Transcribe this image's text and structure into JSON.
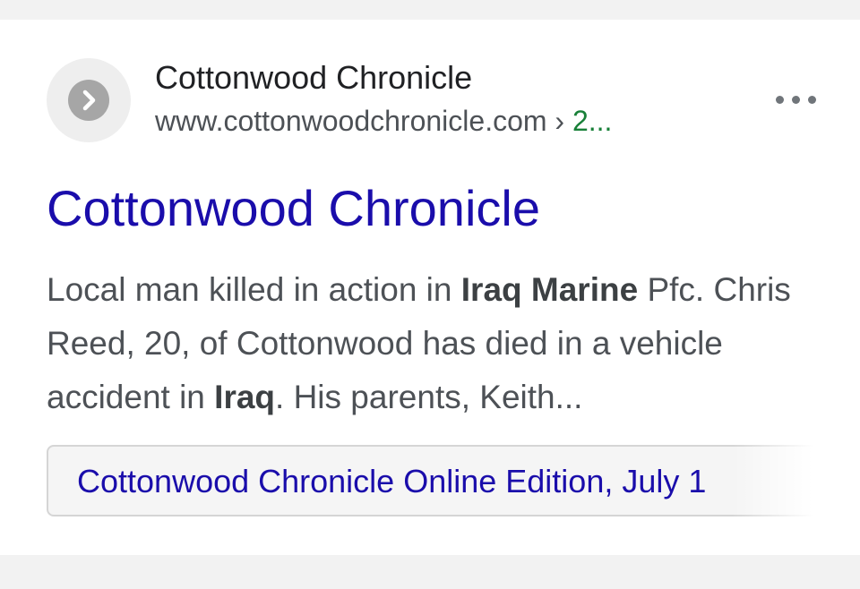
{
  "result": {
    "site_name": "Cottonwood Chronicle",
    "site_url": "www.cottonwoodchronicle.com",
    "url_separator": " › ",
    "url_tail": "2...",
    "favicon_icon": "chevron-right-icon",
    "more_icon": "three-dots-icon",
    "title": "Cottonwood Chronicle",
    "snippet": {
      "part1": "Local man killed in action in ",
      "bold1": "Iraq Marine",
      "part2": " Pfc. Chris Reed, 20, of Cottonwood has died in a vehicle accident in ",
      "bold2": "Iraq",
      "part3": ". His parents, Keith..."
    },
    "chip_label": "Cottonwood Chronicle Online Edition, July 1"
  },
  "colors": {
    "title_link": "#1a0dab",
    "snippet_text": "#4d5156",
    "url_ellipsis": "#188038",
    "page_background": "#f2f2f2",
    "card_background": "#ffffff"
  }
}
